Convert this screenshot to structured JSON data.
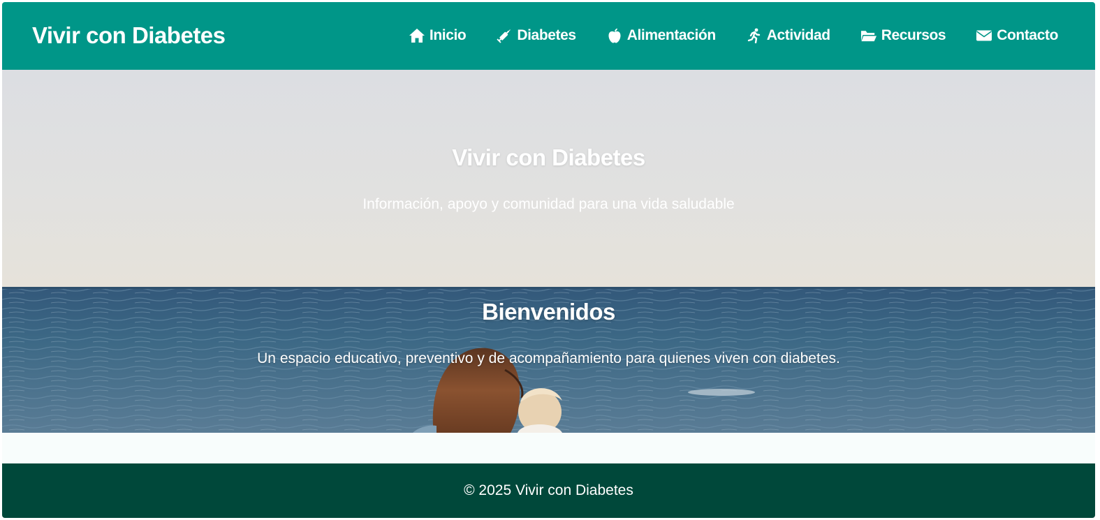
{
  "header": {
    "brand": "Vivir con Diabetes",
    "nav": [
      {
        "label": "Inicio",
        "icon": "home-icon"
      },
      {
        "label": "Diabetes",
        "icon": "syringe-icon"
      },
      {
        "label": "Alimentación",
        "icon": "apple-icon"
      },
      {
        "label": "Actividad",
        "icon": "running-icon"
      },
      {
        "label": "Recursos",
        "icon": "folder-open-icon"
      },
      {
        "label": "Contacto",
        "icon": "envelope-icon"
      }
    ]
  },
  "hero": {
    "title": "Vivir con Diabetes",
    "subtitle": "Información, apoyo y comunidad para una vida saludable"
  },
  "welcome": {
    "title": "Bienvenidos",
    "text": "Un espacio educativo, preventivo y de acompañamiento para quienes viven con diabetes."
  },
  "footer": {
    "text": "© 2025 Vivir con Diabetes"
  },
  "colors": {
    "header_bg": "#009688",
    "footer_bg": "#00483a",
    "sky": "#dcdfe2",
    "sea": "#3a6380",
    "text": "#ffffff"
  }
}
